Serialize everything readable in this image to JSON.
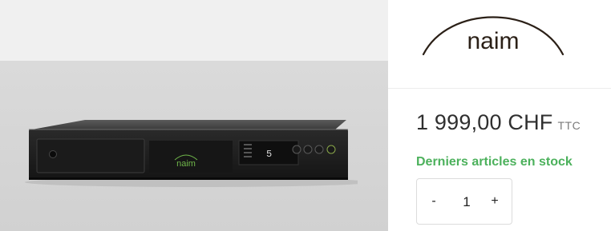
{
  "brand": {
    "logo_text": "naim"
  },
  "product": {
    "device_logo_text": "naim",
    "display_digit": "5",
    "price": "1 999,00 CHF",
    "tax_label": "TTC",
    "stock_status": "Derniers articles en stock"
  },
  "quantity": {
    "minus_label": "-",
    "value": "1",
    "plus_label": "+"
  },
  "colors": {
    "stock_green": "#4cb15c",
    "price_text": "#2f2f2f",
    "device_logo_green": "#6fb64a"
  }
}
